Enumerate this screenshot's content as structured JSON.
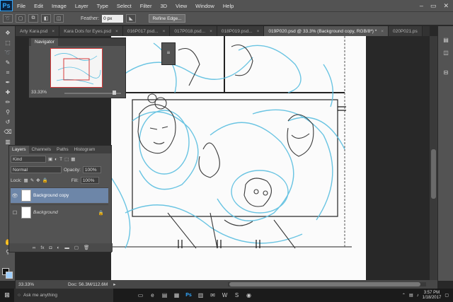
{
  "app": {
    "logo": "Ps"
  },
  "menu": [
    "File",
    "Edit",
    "Image",
    "Layer",
    "Type",
    "Select",
    "Filter",
    "3D",
    "View",
    "Window",
    "Help"
  ],
  "window_controls": [
    "–",
    "▭",
    "✕"
  ],
  "options": {
    "feather_label": "Feather:",
    "feather_value": "0 px",
    "refine_edge": "Refine Edge..."
  },
  "tabs": [
    {
      "label": "Arty Kara.psd"
    },
    {
      "label": "Kara Dots for Eyes.psd"
    },
    {
      "label": "016P017.psd..."
    },
    {
      "label": "017P018.psd..."
    },
    {
      "label": "018P019.psd..."
    },
    {
      "label": "019P020.psd @ 33.3% (Background copy, RGB/8*) *",
      "active": true
    },
    {
      "label": "020P021.ps"
    }
  ],
  "navigator": {
    "title": "Navigator",
    "zoom": "33.33%"
  },
  "layers": {
    "tabs": [
      "Layers",
      "Channels",
      "Paths",
      "Histogram"
    ],
    "filter_kind": "Kind",
    "blend_mode": "Normal",
    "opacity_label": "Opacity:",
    "opacity_value": "100%",
    "lock_label": "Lock:",
    "fill_label": "Fill:",
    "fill_value": "100%",
    "items": [
      {
        "name": "Background copy",
        "selected": true,
        "visible": true
      },
      {
        "name": "Background",
        "selected": false,
        "visible": false,
        "locked": true
      }
    ]
  },
  "status": {
    "zoom": "33.33%",
    "doc": "Doc: 56.3M/112.6M"
  },
  "taskbar": {
    "search_placeholder": "Ask me anything",
    "time": "3:57 PM",
    "date": "1/18/2017"
  }
}
